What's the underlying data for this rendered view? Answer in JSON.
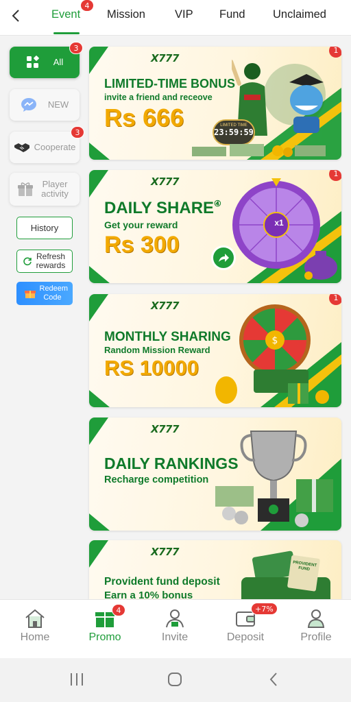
{
  "nav": {
    "tabs": [
      {
        "label": "Event",
        "badge": "4",
        "active": true
      },
      {
        "label": "Mission"
      },
      {
        "label": "VIP"
      },
      {
        "label": "Fund"
      },
      {
        "label": "Unclaimed"
      }
    ]
  },
  "sidebar": {
    "items": [
      {
        "label": "All",
        "badge": "3",
        "icon": "grid-icon"
      },
      {
        "label": "NEW",
        "icon": "chat-bubble-icon"
      },
      {
        "label": "Cooperate",
        "badge": "3",
        "icon": "handshake-icon"
      },
      {
        "label": "Player activity",
        "icon": "gift-icon"
      }
    ],
    "history_label": "History",
    "refresh_label": "Refresh rewards",
    "redeem_label": "Redeem Code"
  },
  "banners": [
    {
      "logo": "X777",
      "title": "LIMITED-TIME BONUS",
      "subtitle": "invite a friend and receove",
      "amount": "Rs 666",
      "timer_label": "LIMITED TIME",
      "timer": "23:59:59",
      "badge": "1"
    },
    {
      "logo": "X777",
      "title": "DAILY SHARE",
      "title_mark": "④",
      "subtitle": "Get your reward",
      "amount": "Rs 300",
      "wheel_center": "x1",
      "badge": "1"
    },
    {
      "logo": "X777",
      "title": "MONTHLY SHARING",
      "subtitle": "Random Mission Reward",
      "amount": "RS 10000",
      "badge": "1"
    },
    {
      "logo": "X777",
      "title": "DAILY RANKINGS",
      "subtitle": "Recharge competition"
    },
    {
      "logo": "X777",
      "title": "Provident fund deposit",
      "subtitle": "Earn a 10% bonus",
      "card_label": "PROVIDENT FUND"
    }
  ],
  "bottom_nav": [
    {
      "label": "Home",
      "icon": "home-icon"
    },
    {
      "label": "Promo",
      "icon": "gift-icon",
      "badge": "4",
      "active": true
    },
    {
      "label": "Invite",
      "icon": "invite-icon"
    },
    {
      "label": "Deposit",
      "icon": "wallet-icon",
      "badge": "+7%"
    },
    {
      "label": "Profile",
      "icon": "profile-icon"
    }
  ],
  "colors": {
    "accent": "#1f9d3a",
    "gold": "#f2a900",
    "badge": "#e53935"
  }
}
